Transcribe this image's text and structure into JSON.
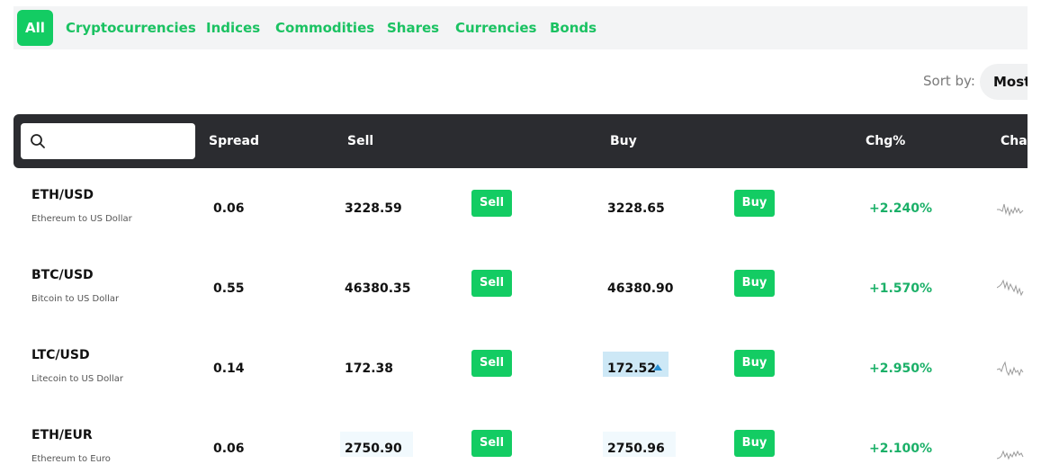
{
  "tabs": [
    {
      "label": "All",
      "active": true
    },
    {
      "label": "Cryptocurrencies",
      "active": false
    },
    {
      "label": "Indices",
      "active": false
    },
    {
      "label": "Commodities",
      "active": false
    },
    {
      "label": "Shares",
      "active": false
    },
    {
      "label": "Currencies",
      "active": false
    },
    {
      "label": "Bonds",
      "active": false
    }
  ],
  "sort": {
    "label": "Sort by:",
    "value": "Most"
  },
  "search": {
    "value": "",
    "placeholder": ""
  },
  "columns": {
    "spread": "Spread",
    "sell": "Sell",
    "buy": "Buy",
    "chg": "Chg%",
    "chart": "Char"
  },
  "buttons": {
    "sell": "Sell",
    "buy": "Buy"
  },
  "rows": [
    {
      "symbol": "ETH/USD",
      "description": "Ethereum to US Dollar",
      "spread": "0.06",
      "sell": "3228.59",
      "buy": "3228.65",
      "chg": "+2.240%"
    },
    {
      "symbol": "BTC/USD",
      "description": "Bitcoin to US Dollar",
      "spread": "0.55",
      "sell": "46380.35",
      "buy": "46380.90",
      "chg": "+1.570%"
    },
    {
      "symbol": "LTC/USD",
      "description": "Litecoin to US Dollar",
      "spread": "0.14",
      "sell": "172.38",
      "buy": "172.52",
      "chg": "+2.950%"
    },
    {
      "symbol": "ETH/EUR",
      "description": "Ethereum to Euro",
      "spread": "0.06",
      "sell": "2750.90",
      "buy": "2750.96",
      "chg": "+2.100%"
    }
  ],
  "colors": {
    "accent": "#13cc63",
    "header_bg": "#2b2c30",
    "tab_text": "#1bc262",
    "change_positive": "#1bb068",
    "highlight": "#cde8f6",
    "price_up_arrow": "#2a8fd0"
  },
  "icons": {
    "search": "search-icon",
    "price_up": "triangle-up-icon"
  }
}
